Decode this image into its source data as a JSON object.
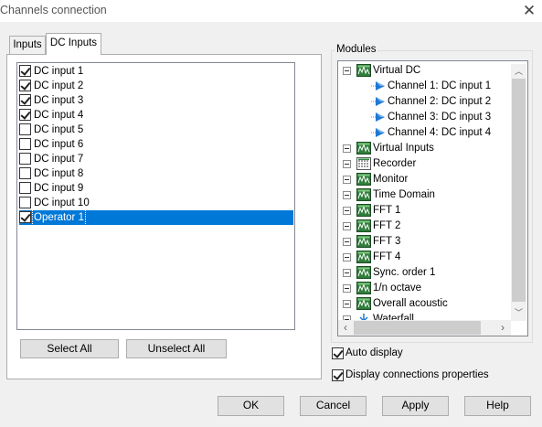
{
  "window": {
    "title": "Channels connection",
    "close_icon": "close-icon"
  },
  "tabs": [
    {
      "label": "Inputs",
      "active": false
    },
    {
      "label": "DC Inputs",
      "active": true
    }
  ],
  "dc_inputs": [
    {
      "label": "DC input 1",
      "checked": true
    },
    {
      "label": "DC input 2",
      "checked": true
    },
    {
      "label": "DC input 3",
      "checked": true
    },
    {
      "label": "DC input 4",
      "checked": true
    },
    {
      "label": "DC input 5",
      "checked": false
    },
    {
      "label": "DC input 6",
      "checked": false
    },
    {
      "label": "DC input 7",
      "checked": false
    },
    {
      "label": "DC input 8",
      "checked": false
    },
    {
      "label": "DC input 9",
      "checked": false
    },
    {
      "label": "DC input 10",
      "checked": false
    },
    {
      "label": "Operator 1",
      "checked": true,
      "selected": true
    }
  ],
  "buttons": {
    "select_all": "Select All",
    "unselect_all": "Unselect All",
    "ok": "OK",
    "cancel": "Cancel",
    "apply": "Apply",
    "help": "Help"
  },
  "modules": {
    "label": "Modules",
    "tree": [
      {
        "label": "Virtual DC",
        "icon": "module-icon",
        "level": 0,
        "expander": true
      },
      {
        "label": "Channel 1: DC input 1",
        "icon": "channel-arrow-icon",
        "level": 1
      },
      {
        "label": "Channel 2: DC input 2",
        "icon": "channel-arrow-icon",
        "level": 1
      },
      {
        "label": "Channel 3: DC input 3",
        "icon": "channel-arrow-icon",
        "level": 1
      },
      {
        "label": "Channel 4: DC input 4",
        "icon": "channel-arrow-icon",
        "level": 1
      },
      {
        "label": "Virtual Inputs",
        "icon": "module-icon",
        "level": 0,
        "expander": true
      },
      {
        "label": "Recorder",
        "icon": "recorder-icon",
        "level": 0,
        "expander": true
      },
      {
        "label": "Monitor",
        "icon": "module-icon",
        "level": 0,
        "expander": true
      },
      {
        "label": "Time Domain",
        "icon": "module-icon",
        "level": 0,
        "expander": true
      },
      {
        "label": "FFT 1",
        "icon": "module-icon",
        "level": 0,
        "expander": true
      },
      {
        "label": "FFT 2",
        "icon": "module-icon",
        "level": 0,
        "expander": true
      },
      {
        "label": "FFT 3",
        "icon": "module-icon",
        "level": 0,
        "expander": true
      },
      {
        "label": "FFT 4",
        "icon": "module-icon",
        "level": 0,
        "expander": true
      },
      {
        "label": "Sync. order 1",
        "icon": "module-icon",
        "level": 0,
        "expander": true
      },
      {
        "label": "1/n octave",
        "icon": "module-icon",
        "level": 0,
        "expander": true
      },
      {
        "label": "Overall acoustic",
        "icon": "module-icon",
        "level": 0,
        "expander": true
      },
      {
        "label": "Waterfall",
        "icon": "waterfall-icon",
        "level": 0,
        "expander": true
      }
    ]
  },
  "options": {
    "auto_display": {
      "label": "Auto display",
      "checked": true
    },
    "display_connections": {
      "label": "Display connections properties",
      "checked": true
    }
  },
  "colors": {
    "selection": "#0078d7",
    "module_icon_bg": "#2f7d3a",
    "channel_arrow": "#1e78d6"
  }
}
